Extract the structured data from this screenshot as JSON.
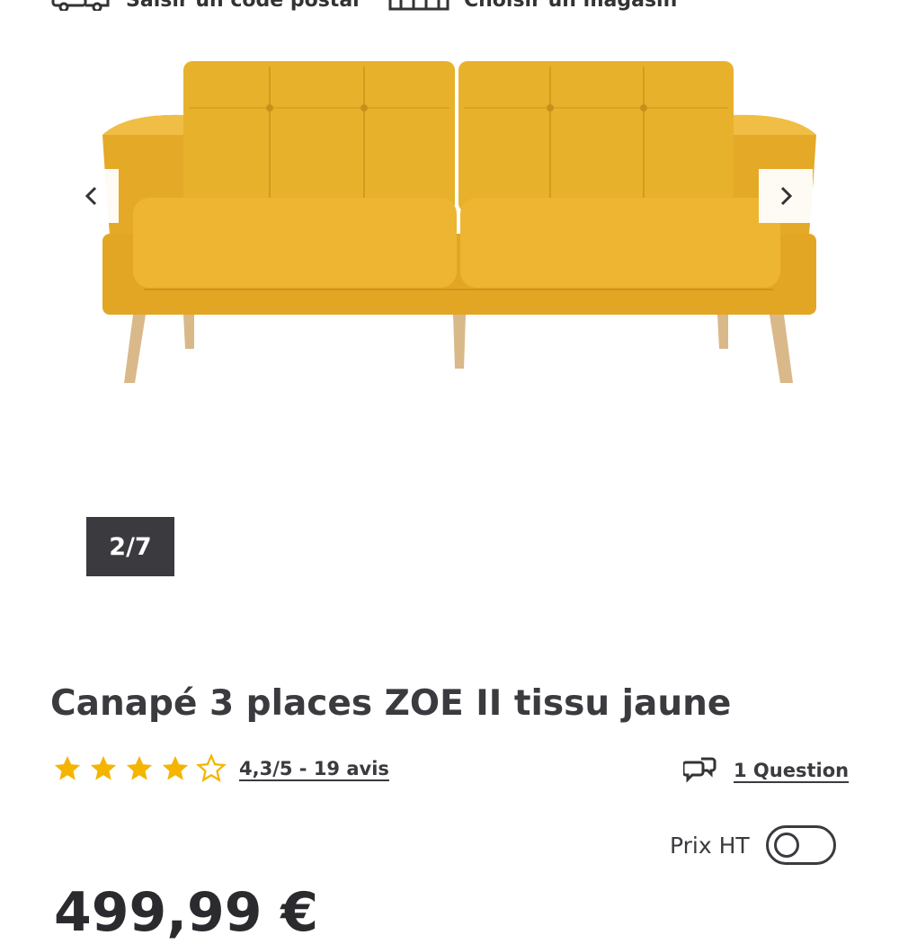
{
  "delivery": {
    "postcode_label": "Saisir un code postal",
    "store_label": "Choisir un magasin"
  },
  "gallery": {
    "counter": "2/7",
    "product_color": "#E8B12C",
    "leg_color": "#D9B98A"
  },
  "product": {
    "title": "Canapé 3 places ZOE II tissu jaune",
    "rating_value": 4.3,
    "rating_stars_filled": 4,
    "rating_stars_total": 5,
    "rating_text": "4,3/5 - 19 avis",
    "question_label": "1 Question",
    "price_partial": "499,99 €"
  },
  "pricing": {
    "prix_ht_label": "Prix HT",
    "prix_ht_enabled": false
  },
  "colors": {
    "star": "#F5B400",
    "text": "#3A3A3F"
  }
}
